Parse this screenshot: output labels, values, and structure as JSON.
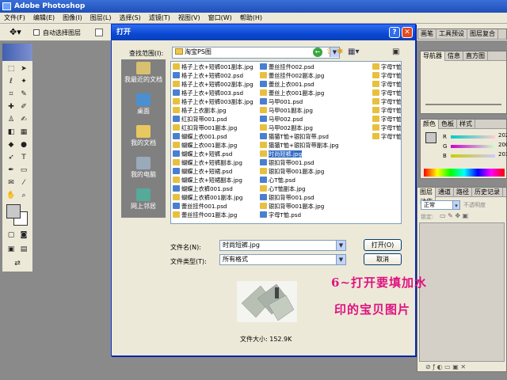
{
  "app": {
    "title": "Adobe Photoshop"
  },
  "menu": [
    "文件(F)",
    "编辑(E)",
    "图像(I)",
    "图层(L)",
    "选择(S)",
    "滤镜(T)",
    "视图(V)",
    "窗口(W)",
    "帮助(H)"
  ],
  "options": {
    "auto_select_label": "自动选择图层"
  },
  "right_tabs": {
    "top": [
      "画笔",
      "工具预设",
      "图层复合"
    ],
    "nav": [
      "导航器",
      "信息",
      "直方图"
    ],
    "color": [
      "颜色",
      "色板",
      "样式"
    ],
    "color_values": [
      "202",
      "200",
      "203"
    ],
    "layers": [
      "图层",
      "通道",
      "路径",
      "历史记录",
      "动作"
    ],
    "blend_mode": "正常",
    "opacity_label": "不透明度",
    "lock_label": "锁定:"
  },
  "dialog": {
    "title": "打开",
    "lookin_label": "查找范围(I):",
    "lookin_value": "淘宝PS图",
    "places": [
      "我最近的文档",
      "桌面",
      "我的文档",
      "我的电脑",
      "网上邻居"
    ],
    "files_col1": [
      "格子上衣+短裤001副本.jpg",
      "格子上衣+短裤002.psd",
      "格子上衣+短裤002副本.jpg",
      "格子上衣+短裤003.psd",
      "格子上衣+短裤003副本.jpg",
      "格子上衣副本.jpg",
      "红扣背带001.psd",
      "红扣背带001副本.jpg",
      "蝴蝶上衣001.psd",
      "蝴蝶上衣001副本.jpg",
      "蝴蝶上衣+短裤.psd",
      "蝴蝶上衣+短裤副本.jpg",
      "蝴蝶上衣+短裙.psd",
      "蝴蝶上衣+短裙副本.jpg",
      "蝴蝶上衣裤001.psd",
      "蝴蝶上衣裤001副本.jpg",
      "蕾丝挂件001.psd",
      "蕾丝挂件001副本.jpg"
    ],
    "files_col2": [
      "蕾丝挂件002.psd",
      "蕾丝挂件002副本.jpg",
      "蕾丝上衣001.psd",
      "蕾丝上衣001副本.jpg",
      "马甲001.psd",
      "马甲001副本.jpg",
      "马甲002.psd",
      "马甲002副本.jpg",
      "猫猫T恤+银扣背带.psd",
      "猫猫T恤+银扣背带副本.jpg",
      "时尚短裤.jpg",
      "银扣背带001.psd",
      "银扣背带001副本.jpg",
      "心T恤.psd",
      "心T恤副本.jpg",
      "银扣背带001.psd",
      "银扣背带001副本.jpg",
      "字母T恤.psd"
    ],
    "files_col3": [
      "字母T恤",
      "字母T恤",
      "字母T恤",
      "字母T恤",
      "字母T恤",
      "字母T恤",
      "字母T恤",
      "字母T恤",
      "字母T恤"
    ],
    "selected_file": "时尚短裤.jpg",
    "filename_label": "文件名(N):",
    "filename_value": "时尚短裤.jpg",
    "filetype_label": "文件类型(T):",
    "filetype_value": "所有格式",
    "open_button": "打开(O)",
    "cancel_button": "取消",
    "filesize": "文件大小: 152.9K"
  },
  "annotation": {
    "line1": "6~打开要填加水",
    "line2": "印的宝贝图片",
    "color": "#e0127f"
  }
}
